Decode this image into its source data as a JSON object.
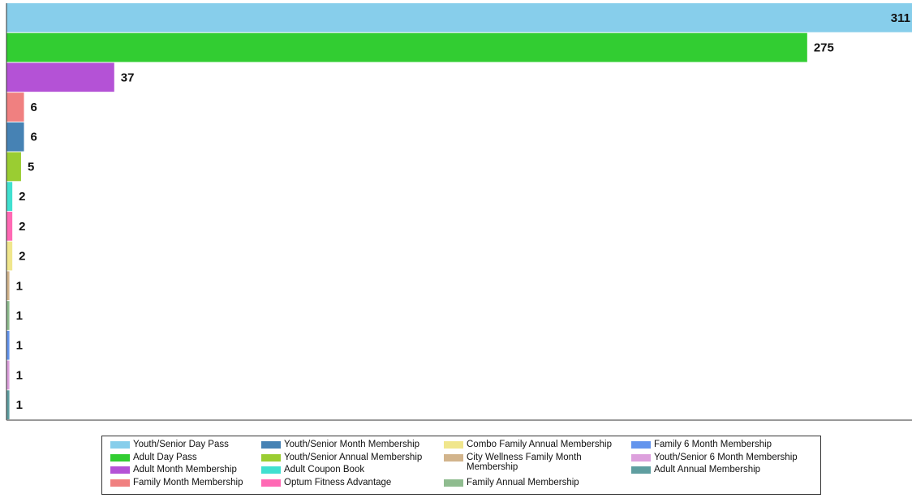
{
  "chart_data": {
    "type": "bar",
    "orientation": "horizontal",
    "xlim": [
      0,
      311
    ],
    "grid": false,
    "legend_position": "bottom",
    "data_labels": true,
    "categories": [
      "Youth/Senior Day Pass",
      "Adult Day Pass",
      "Adult Month Membership",
      "Family Month Membership",
      "Youth/Senior Month Membership",
      "Youth/Senior Annual Membership",
      "Adult Coupon Book",
      "Optum Fitness Advantage",
      "Combo Family Annual Membership",
      "City Wellness Family Month Membership",
      "Family Annual Membership",
      "Family 6 Month Membership",
      "Youth/Senior 6 Month Membership",
      "Adult Annual Membership"
    ],
    "values": [
      311,
      275,
      37,
      6,
      6,
      5,
      2,
      2,
      2,
      1,
      1,
      1,
      1,
      1
    ],
    "colors": [
      "#87ceeb",
      "#32cd32",
      "#b452d6",
      "#f08080",
      "#4682b4",
      "#9acd32",
      "#40e0d0",
      "#ff69b4",
      "#f0e68c",
      "#d2b48c",
      "#8fbc8f",
      "#6495ed",
      "#dda0dd",
      "#5f9ea0"
    ],
    "legend": {
      "columns": [
        [
          0,
          1,
          2,
          3
        ],
        [
          4,
          5,
          6,
          7
        ],
        [
          8,
          9,
          10
        ],
        [
          11,
          12,
          13
        ]
      ]
    }
  }
}
